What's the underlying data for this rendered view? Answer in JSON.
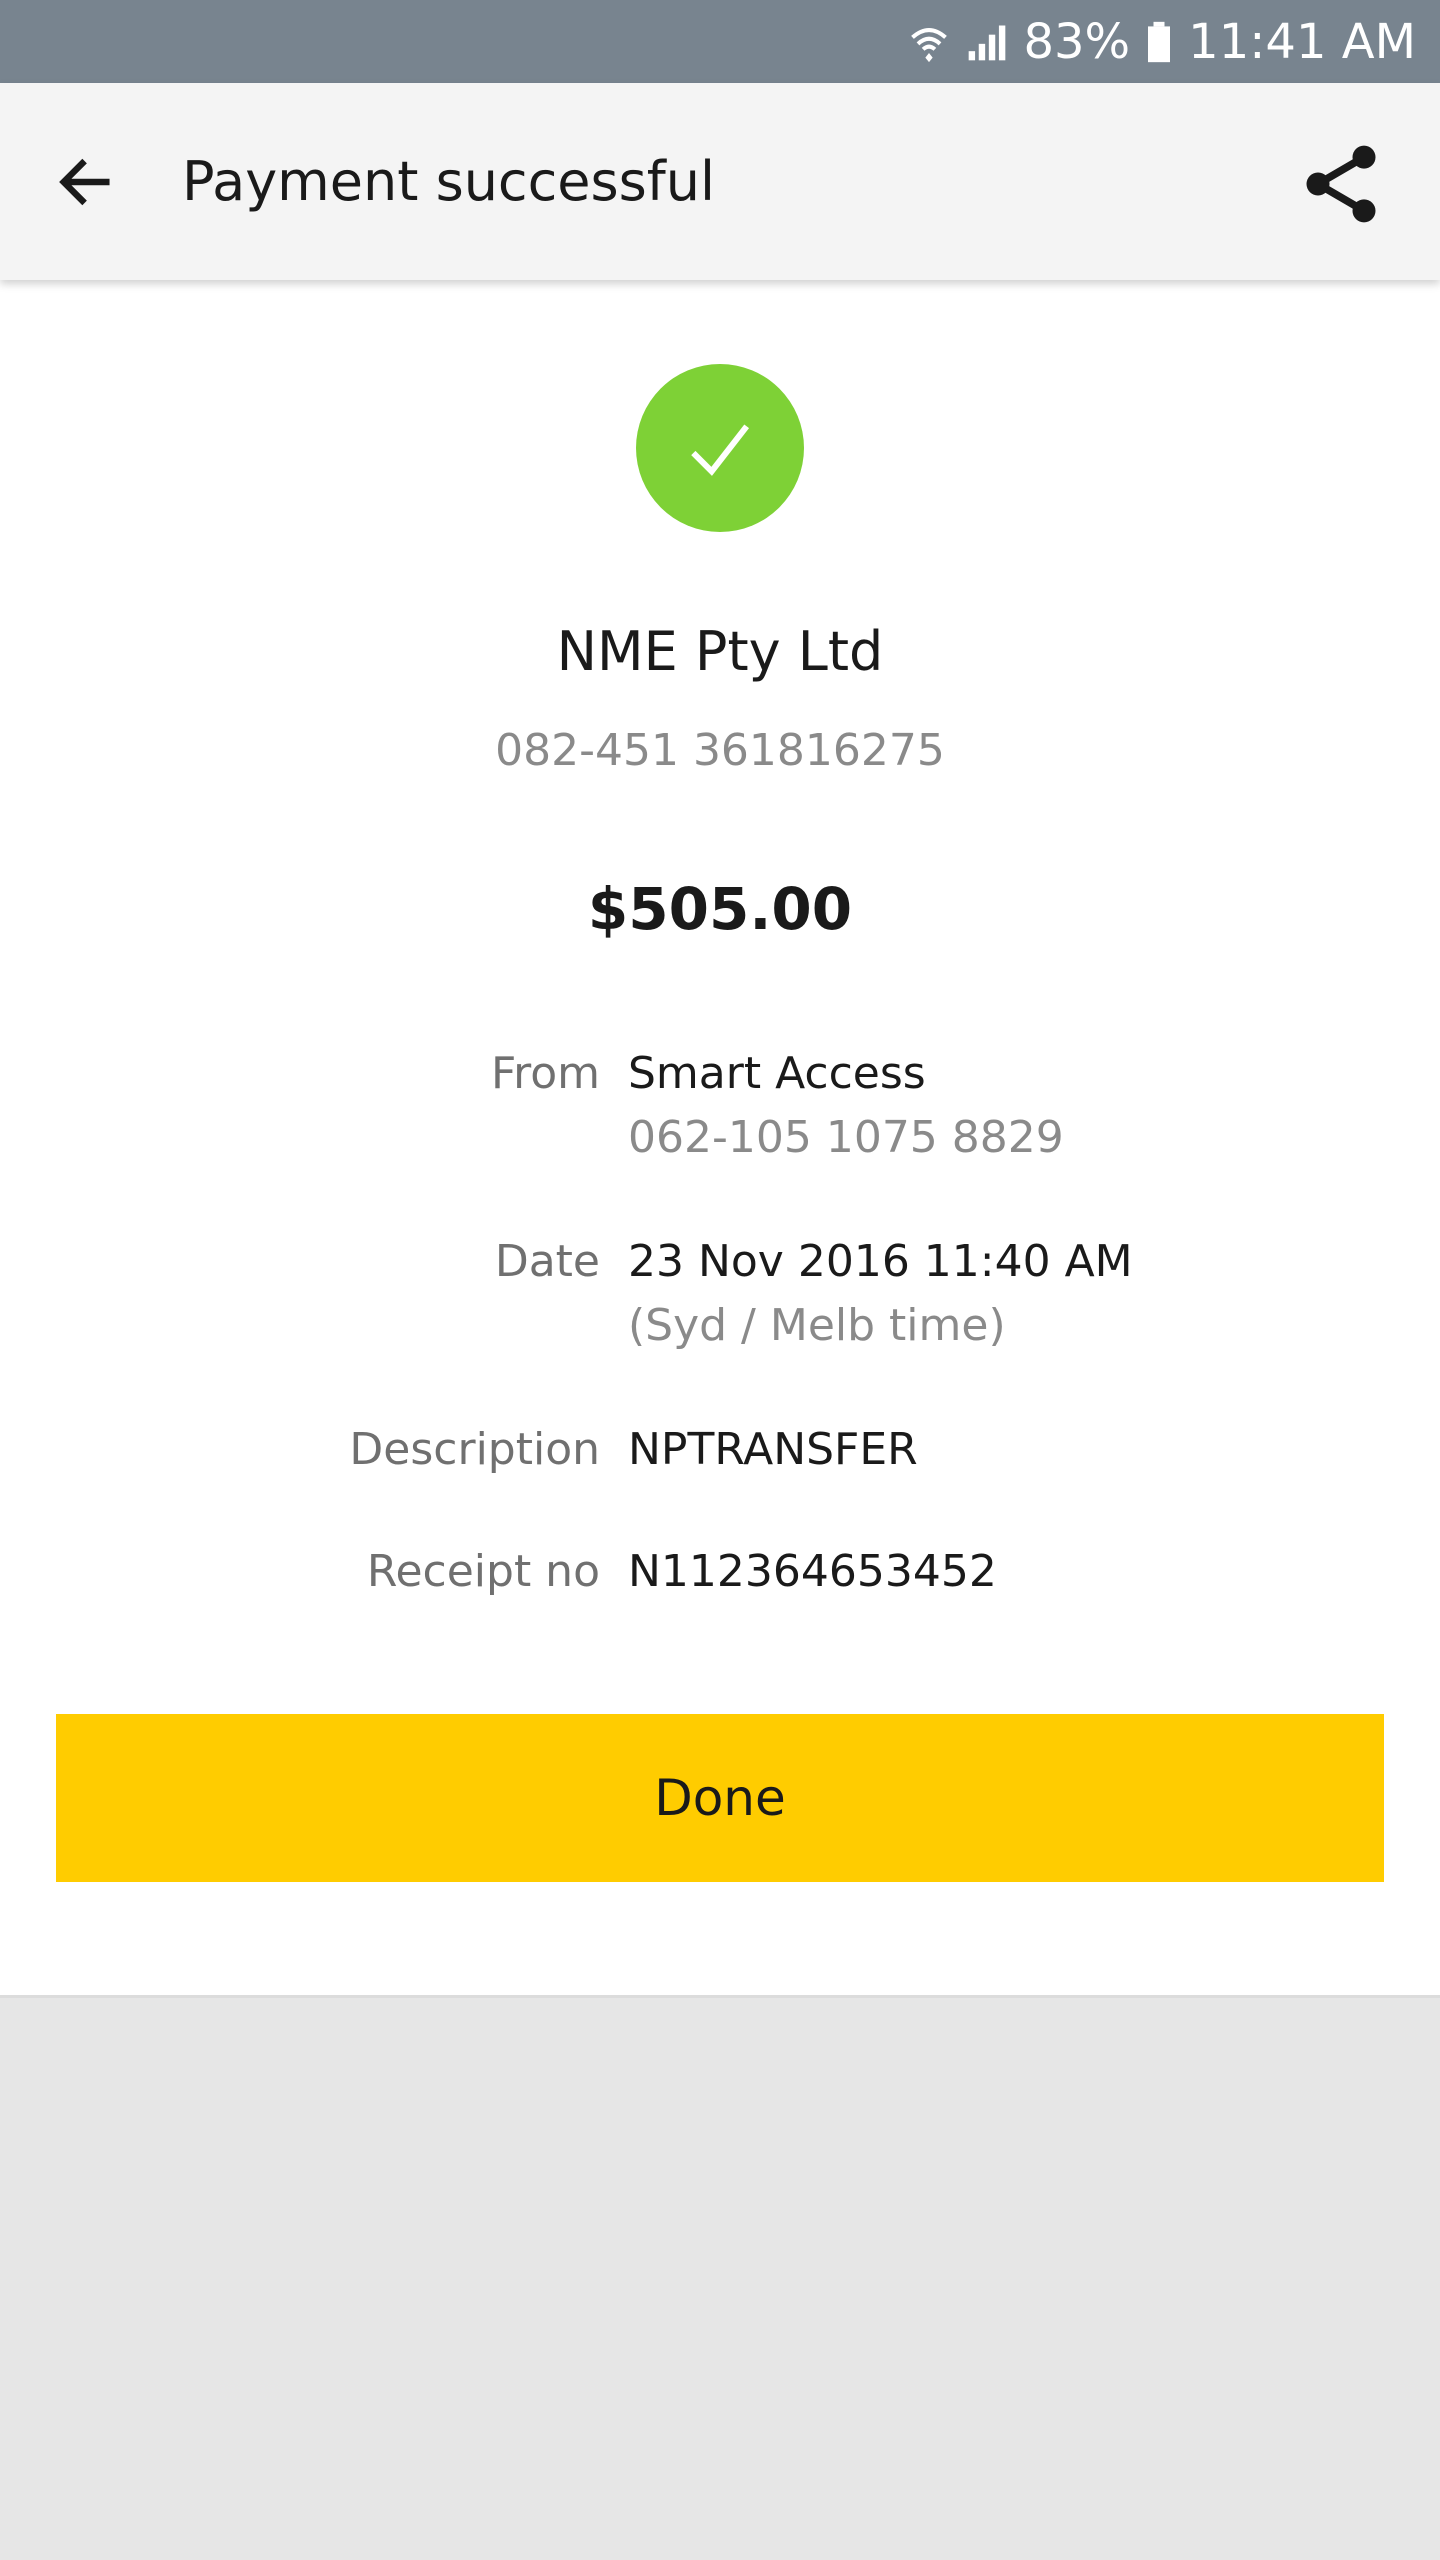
{
  "status_bar": {
    "battery": "83%",
    "time": "11:41 AM",
    "icons": [
      "wifi-icon",
      "signal-icon",
      "battery-icon"
    ]
  },
  "app_bar": {
    "title": "Payment successful",
    "back_icon": "arrow-left-icon",
    "share_icon": "share-icon"
  },
  "status_icon": "check-circle-icon",
  "payee": {
    "name": "NME Pty Ltd",
    "account": "082-451 361816275"
  },
  "amount": "$505.00",
  "details": {
    "from": {
      "label": "From",
      "value": "Smart Access",
      "sub": "062-105 1075 8829"
    },
    "date": {
      "label": "Date",
      "value": "23 Nov 2016 11:40 AM",
      "sub": "(Syd / Melb time)"
    },
    "description": {
      "label": "Description",
      "value": "NPTRANSFER"
    },
    "receipt": {
      "label": "Receipt no",
      "value": "N112364653452"
    }
  },
  "done_button": {
    "label": "Done"
  },
  "colors": {
    "status_bar": "#78848f",
    "app_bar": "#f4f4f4",
    "success_green": "#7ed136",
    "accent_yellow": "#ffcc00",
    "background": "#e6e6e6"
  }
}
